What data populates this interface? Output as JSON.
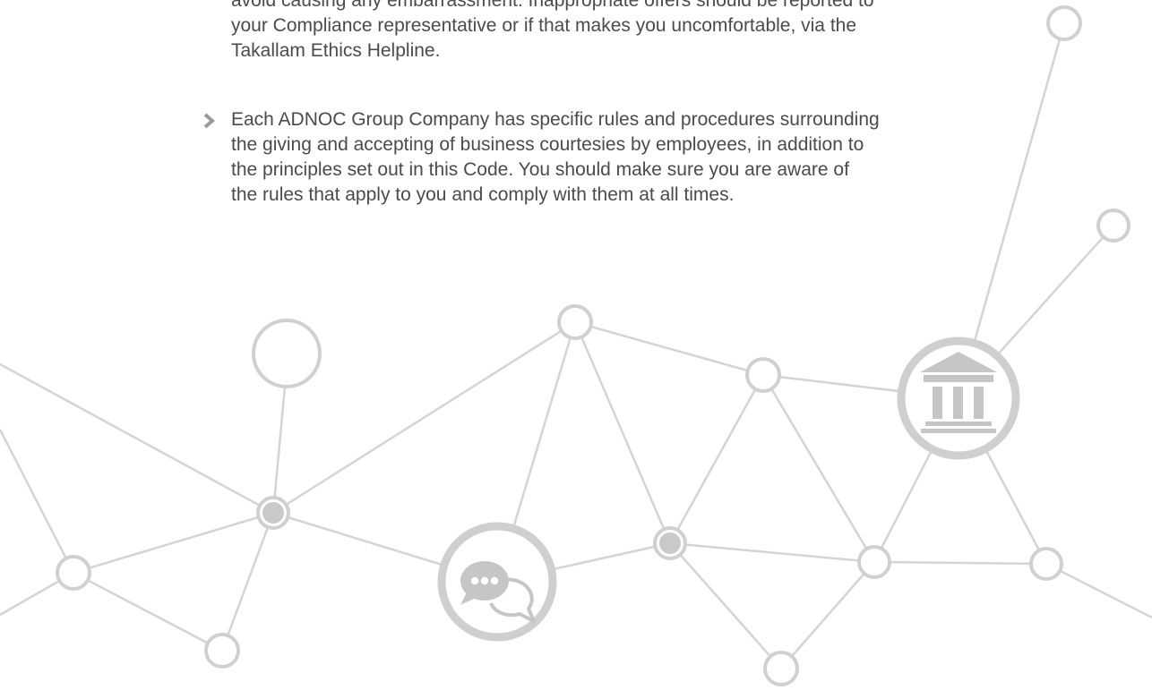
{
  "paragraphs": {
    "continuation_line1": "avoid causing any embarrassment. Inappropriate offers should be reported to",
    "continuation_line2": "your Compliance representative or if that makes you uncomfortable, via the",
    "continuation_line3": "Takallam Ethics Helpline.",
    "bullet_line1": "Each ADNOC Group Company has specific rules and procedures surrounding",
    "bullet_line2": "the giving and accepting of business courtesies by employees, in addition to",
    "bullet_line3": "the principles set out in this Code. You should make sure you are aware of",
    "bullet_line4": "the rules that apply to you and comply with them at all times."
  },
  "icons": {
    "bullet": "chevron-right-icon",
    "chat": "chat-bubbles-icon",
    "institution": "bank-building-icon"
  },
  "colors": {
    "text": "#4b4b4b",
    "bullet": "#9a9a9a",
    "network_line": "#cdcdcd",
    "node_fill": "#c9c9c9"
  }
}
